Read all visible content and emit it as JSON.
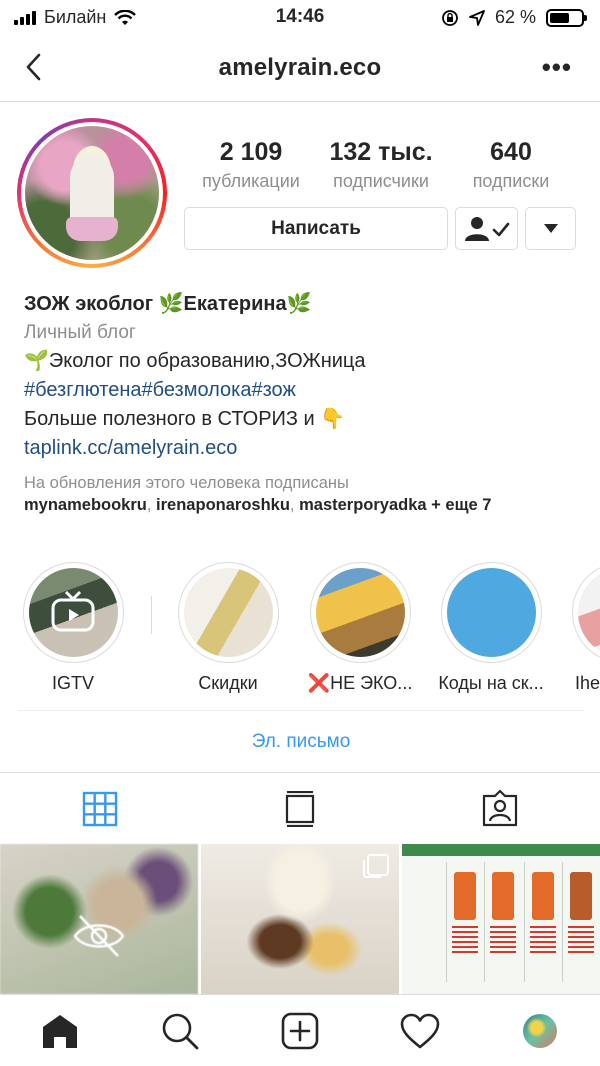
{
  "status": {
    "carrier": "Билайн",
    "time": "14:46",
    "battery": "62 %",
    "battery_level": 0.62
  },
  "nav": {
    "title": "amelyrain.eco"
  },
  "stats": [
    {
      "value": "2 109",
      "label": "публикации"
    },
    {
      "value": "132 тыс.",
      "label": "подписчики"
    },
    {
      "value": "640",
      "label": "подписки"
    }
  ],
  "actions": {
    "message": "Написать"
  },
  "bio": {
    "name": "ЗОЖ экоблог 🌿Екатерина🌿",
    "category": "Личный блог",
    "line1": "🌱Эколог по образованию,ЗОЖница",
    "hashtags": "#безглютена#безмолока#зож",
    "line3": "Больше полезного в СТОРИЗ и 👇",
    "link": "taplink.cc/amelyrain.eco"
  },
  "followed_by": {
    "caption": "На обновления этого человека подписаны",
    "users": [
      "mynamebookru",
      "irenaponaroshku",
      "masterporyadka"
    ],
    "more": "+ еще 7"
  },
  "highlights": [
    {
      "label": "IGTV"
    },
    {
      "label": "Скидки"
    },
    {
      "label": "❌НЕ ЭКО..."
    },
    {
      "label": "Коды на ск..."
    },
    {
      "label": "Ihe"
    }
  ],
  "email": {
    "label": "Эл. письмо"
  },
  "icons": {
    "back": "chevron-left-icon",
    "more": "more-horizontal-icon",
    "follow": "person-check-icon",
    "dropdown": "chevron-down-icon",
    "grid": "grid-icon",
    "feed": "feed-icon",
    "tagged": "tagged-icon",
    "home": "home-icon",
    "search": "search-icon",
    "add": "add-post-icon",
    "activity": "heart-icon"
  },
  "colors": {
    "link": "#1f4f80",
    "accent": "#3897f0",
    "muted": "#8e8e8e",
    "text": "#262626"
  }
}
